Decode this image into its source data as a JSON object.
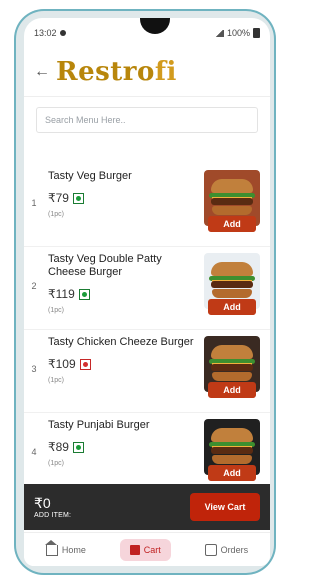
{
  "status_bar": {
    "time": "13:02",
    "battery": "100%"
  },
  "header": {
    "logo_main": "Restro",
    "logo_suffix": "fi"
  },
  "search": {
    "placeholder": "Search Menu Here.."
  },
  "menu": {
    "items": [
      {
        "index": "1",
        "name": "Tasty Veg Burger",
        "price": "₹79",
        "type": "veg",
        "qty": "(1pc)",
        "add_label": "Add"
      },
      {
        "index": "2",
        "name": "Tasty Veg Double Patty Cheese Burger",
        "price": "₹119",
        "type": "veg",
        "qty": "(1pc)",
        "add_label": "Add"
      },
      {
        "index": "3",
        "name": "Tasty Chicken Cheeze Burger",
        "price": "₹109",
        "type": "nonveg",
        "qty": "(1pc)",
        "add_label": "Add"
      },
      {
        "index": "4",
        "name": "Tasty Punjabi Burger",
        "price": "₹89",
        "type": "veg",
        "qty": "(1pc)",
        "add_label": "Add"
      }
    ]
  },
  "cart_bar": {
    "total": "₹0",
    "sub_label": "ADD ITEM:",
    "button_label": "View Cart"
  },
  "tabs": [
    {
      "label": "Home",
      "icon": "home-icon"
    },
    {
      "label": "Cart",
      "icon": "cart-icon",
      "active": true
    },
    {
      "label": "Orders",
      "icon": "orders-icon"
    }
  ],
  "colors": {
    "accent": "#c03a16",
    "logo": "#b8860b",
    "veg": "#1b9b3a",
    "nonveg": "#d32f2f"
  }
}
